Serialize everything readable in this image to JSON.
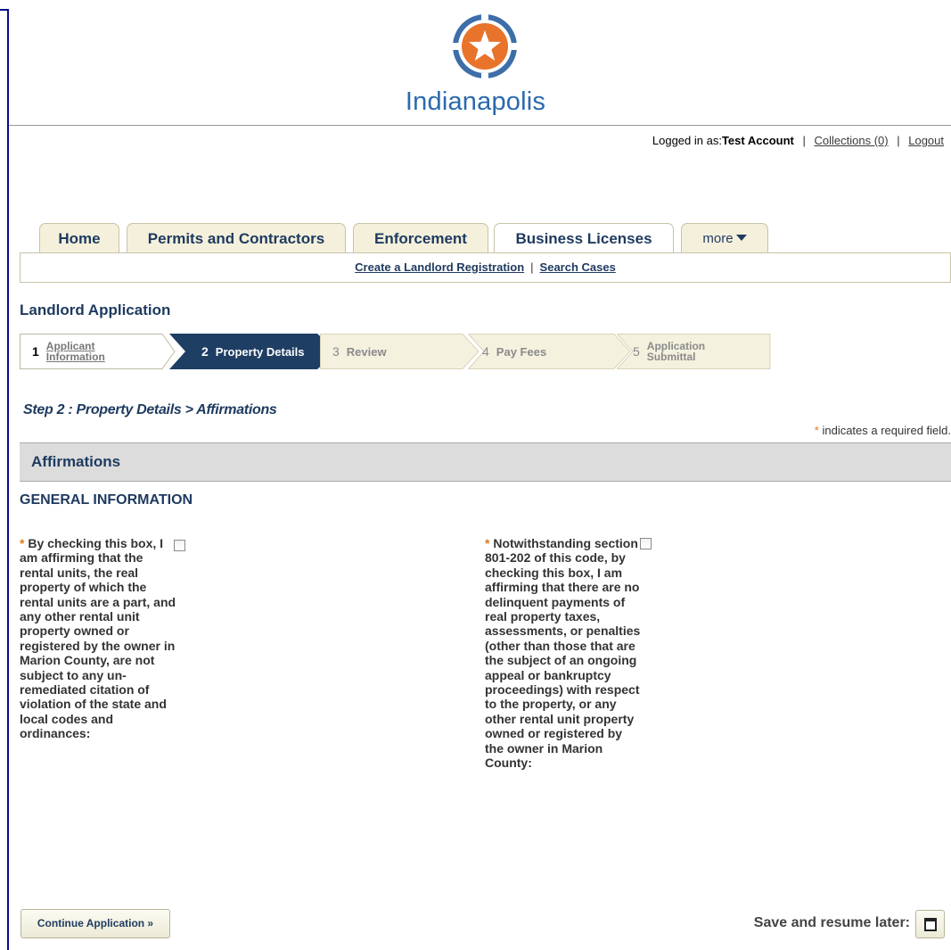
{
  "brand": {
    "name": "Indianapolis",
    "primary": "#2a6aac",
    "accent": "#e8732a"
  },
  "account": {
    "logged_in_label": "Logged in as:",
    "user": "Test Account",
    "collections": "Collections (0)",
    "logout": "Logout"
  },
  "tabs": [
    {
      "label": "Home"
    },
    {
      "label": "Permits and Contractors"
    },
    {
      "label": "Enforcement"
    },
    {
      "label": "Business Licenses",
      "active": true
    },
    {
      "label": "more"
    }
  ],
  "subnav": {
    "create": "Create a Landlord Registration",
    "search": "Search Cases"
  },
  "page_title": "Landlord Application",
  "steps": [
    {
      "num": "1",
      "label": "Applicant Information",
      "state": "done"
    },
    {
      "num": "2",
      "label": "Property Details",
      "state": "current"
    },
    {
      "num": "3",
      "label": "Review",
      "state": "pending"
    },
    {
      "num": "4",
      "label": "Pay Fees",
      "state": "pending"
    },
    {
      "num": "5",
      "label": "Application Submittal",
      "state": "pending"
    }
  ],
  "step_heading": "Step 2 : Property Details > Affirmations",
  "required_note": {
    "star": "*",
    "text": "indicates a required field."
  },
  "section": "Affirmations",
  "general_info": "GENERAL INFORMATION",
  "affirmations": [
    {
      "star": "*",
      "text": "By checking this box, I am affirming that the rental units, the real property of which the rental units are a part, and any other rental unit property owned or registered by the owner in Marion County, are not subject to any un-remediated citation of violation of the state and local codes and ordinances:",
      "checked": false
    },
    {
      "star": "*",
      "text": "Notwithstanding section 801-202 of this code, by checking this box, I am affirming that there are no delinquent payments of real property taxes, assessments, or penalties (other than those that are the subject of an ongoing appeal or bankruptcy proceedings) with respect to the property, or any other rental unit property owned or registered by the owner in Marion County:",
      "checked": false
    }
  ],
  "buttons": {
    "continue": "Continue Application »",
    "save_later": "Save and resume later:"
  }
}
